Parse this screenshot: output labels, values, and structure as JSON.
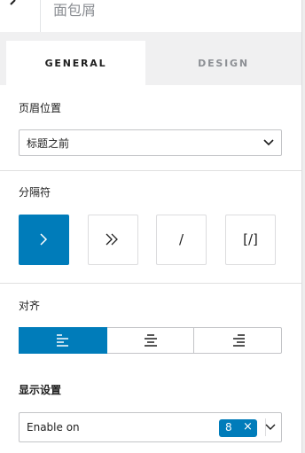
{
  "header": {
    "back_icon": "chevron-left-icon",
    "title": "面包屑"
  },
  "tabs": [
    {
      "label": "GENERAL",
      "active": true
    },
    {
      "label": "DESIGN",
      "active": false
    }
  ],
  "position": {
    "label": "页眉位置",
    "selected": "标题之前"
  },
  "separator": {
    "label": "分隔符",
    "options": [
      {
        "glyph": "›",
        "name": "single-chevron",
        "active": true
      },
      {
        "glyph": "»",
        "name": "double-chevron",
        "active": false
      },
      {
        "glyph": "/",
        "name": "slash",
        "active": false
      },
      {
        "glyph": "[/]",
        "name": "custom",
        "active": false
      }
    ]
  },
  "alignment": {
    "label": "对齐",
    "options": [
      {
        "name": "align-left",
        "active": true
      },
      {
        "name": "align-center",
        "active": false
      },
      {
        "name": "align-right",
        "active": false
      }
    ]
  },
  "display": {
    "label": "显示设置",
    "field_label": "Enable on",
    "badge_count": "8",
    "badge_remove": "×"
  },
  "colors": {
    "accent": "#007cba",
    "border": "#c3c4c7",
    "muted": "#8c8f94"
  }
}
